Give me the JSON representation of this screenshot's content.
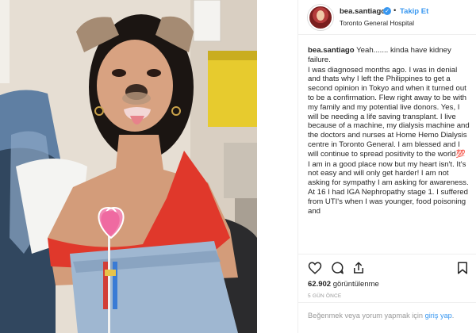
{
  "post": {
    "username": "bea.santiago",
    "separator": "•",
    "follow_label": "Takip Et",
    "location": "Toronto General Hospital",
    "caption_user": "bea.santiago",
    "caption_first": "Yeah....... kinda have kidney failure.",
    "paragraphs": [
      "I was diagnosed months ago. I was in denial and thats why I left the Philippines to get a second opinion in Tokyo and when it turned out to be a confirmation. Flew right away to be with my family and my potential live donors. Yes, I will be needing a life saving transplant. I live because of a machine, my dialysis machine and the doctors and nurses at Home Hemo Dialysis centre in Toronto General. I am blessed and I will continue to spread positivity to the world💯",
      "I am in a good place now but my heart isn't. It's not easy and will only get harder! I am not asking for sympathy I am asking for awareness. At 16 I had IGA Nephropathy stage 1. I suffered from UTI's when I was younger, food poisoning and"
    ],
    "views_count": "62.902",
    "views_label": "görüntülenme",
    "age": "5 GÜN ÖNCE",
    "login_prompt": "Beğenmek veya yorum yapmak için ",
    "login_link": "giriş yap",
    "login_suffix": "."
  },
  "icons": {
    "verified": "verified-badge-icon",
    "like": "heart-icon",
    "comment": "comment-bubble-icon",
    "share": "share-icon",
    "save": "bookmark-icon"
  },
  "colors": {
    "accent_blue": "#3897f0",
    "text": "#262626",
    "muted": "#999999",
    "border": "#efefef"
  }
}
